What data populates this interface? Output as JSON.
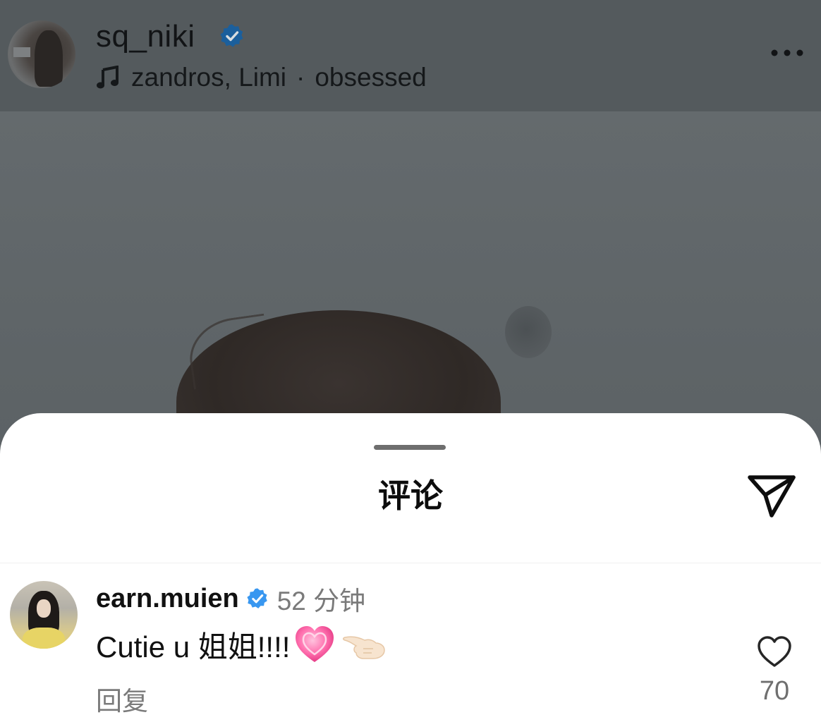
{
  "post": {
    "username": "sq_niki",
    "verified_icon": "verified-badge-icon",
    "music": {
      "icon": "music-note-icon",
      "artists": "zandros, Limi",
      "separator": "·",
      "song": "obsessed"
    },
    "menu_icon": "more-options-icon"
  },
  "comments_sheet": {
    "title": "评论",
    "share_icon": "send-icon",
    "comments": [
      {
        "username": "earn.muien",
        "time": "52 分钟",
        "text": "Cutie u 姐姐!!!!",
        "emojis": [
          "growing-heart-emoji",
          "pointing-hand-emoji"
        ],
        "reply_label": "回复",
        "like_icon": "heart-outline-icon",
        "like_count": "70"
      }
    ]
  },
  "colors": {
    "verified_blue": "#3897f0",
    "overlay_gray": "#5a6064",
    "sheet_bg": "#ffffff",
    "secondary_text": "#7a7a7a"
  }
}
